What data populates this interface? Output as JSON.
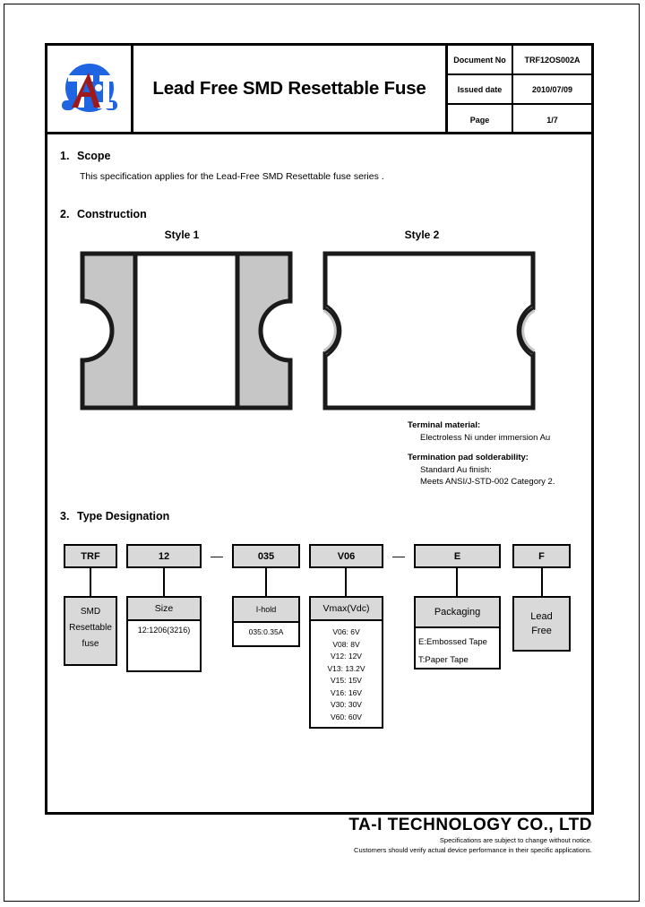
{
  "header": {
    "logo_icon": "ta-i-logo-icon",
    "title": "Lead Free SMD Resettable Fuse",
    "meta": [
      {
        "label": "Document No",
        "value": "TRF12OS002A"
      },
      {
        "label": "Issued date",
        "value": "2010/07/09"
      },
      {
        "label": "Page",
        "value": "1/7"
      }
    ]
  },
  "sections": {
    "scope": {
      "number": "1.",
      "title": "Scope",
      "text": "This specification applies for the Lead-Free SMD Resettable fuse series ."
    },
    "construction": {
      "number": "2.",
      "title": "Construction",
      "style1_label": "Style 1",
      "style2_label": "Style 2",
      "notes": {
        "terminal_heading": "Terminal material:",
        "terminal_text": "Electroless Ni under immersion Au",
        "solder_heading": "Termination pad solderability:",
        "solder_line1": "Standard Au finish:",
        "solder_line2": "Meets ANSI/J-STD-002 Category 2."
      }
    },
    "type_designation": {
      "number": "3.",
      "title": "Type Designation",
      "codes": [
        {
          "code": "TRF"
        },
        {
          "code": "12"
        },
        {
          "code": "035"
        },
        {
          "code": "V06"
        },
        {
          "code": "E"
        },
        {
          "code": "F"
        }
      ],
      "separator": "—",
      "descriptors": {
        "trf": {
          "line1": "SMD",
          "line2": "Resettable",
          "line3": "fuse"
        },
        "size": {
          "head": "Size",
          "body": "12:1206(3216)"
        },
        "ihold": {
          "head": "I-hold",
          "body": "035:0.35A"
        },
        "vmax": {
          "head": "Vmax(Vdc)",
          "items": [
            "V06: 6V",
            "V08: 8V",
            "V12: 12V",
            "V13: 13.2V",
            "V15: 15V",
            "V16: 16V",
            "V30: 30V",
            "V60: 60V"
          ]
        },
        "packaging": {
          "head": "Packaging",
          "line1": "E:Embossed Tape",
          "line2": "T:Paper Tape"
        },
        "leadfree": {
          "line1": "Lead",
          "line2": "Free"
        }
      }
    }
  },
  "footer": {
    "company": "TA-I TECHNOLOGY CO., LTD",
    "note1": "Specifications are subject to change without notice.",
    "note2": "Customers should verify actual device performance in their specific applications."
  },
  "colors": {
    "logo_blue": "#1f64e0",
    "logo_red": "#9e1a1a",
    "box_fill": "#d9d9d9",
    "line": "#000000"
  }
}
